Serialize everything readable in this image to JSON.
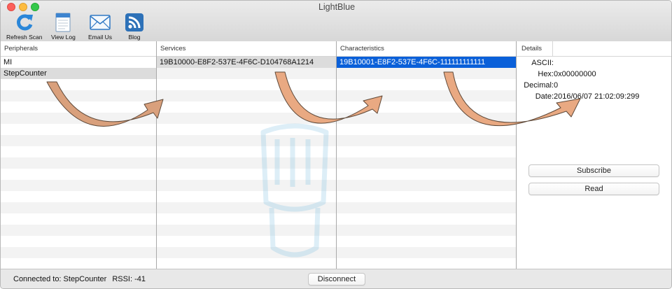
{
  "window": {
    "title": "LightBlue"
  },
  "toolbar": {
    "refresh_label": "Refresh Scan",
    "viewlog_label": "View Log",
    "email_label": "Email Us",
    "blog_label": "Blog"
  },
  "peripherals": {
    "header": "Peripherals",
    "items": [
      "MI",
      "StepCounter"
    ]
  },
  "services": {
    "header": "Services",
    "items": [
      "19B10000-E8F2-537E-4F6C-D104768A1214"
    ]
  },
  "characteristics": {
    "header": "Characteristics",
    "items": [
      "19B10001-E8F2-537E-4F6C-111111111111"
    ]
  },
  "details": {
    "header": "Details",
    "ascii_label": "ASCII:",
    "ascii_value": "",
    "hex_label": "Hex:",
    "hex_value": "0x00000000",
    "decimal_label": "Decimal:",
    "decimal_value": "0",
    "date_label": "Date:",
    "date_value": "2016/06/07 21:02:09:299",
    "subscribe_label": "Subscribe",
    "read_label": "Read"
  },
  "status": {
    "connected_text": "Connected to: StepCounter",
    "rssi_text": "RSSI: -41",
    "disconnect_label": "Disconnect"
  },
  "colors": {
    "selection_blue": "#0a60d9",
    "arrow_fill": "#f2a77a",
    "arrow_dark": "#b8855f"
  }
}
